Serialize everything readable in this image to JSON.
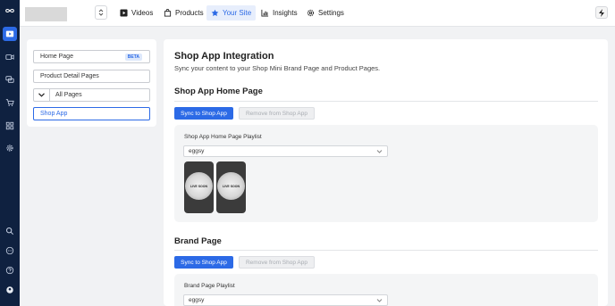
{
  "rail": {
    "top_icons": [
      "infinity-logo-icon",
      "video-library-icon",
      "camera-icon",
      "chat-icon",
      "cart-icon",
      "grid-icon",
      "gear-icon"
    ],
    "bottom_icons": [
      "search-icon",
      "message-icon",
      "help-icon",
      "profile-icon"
    ]
  },
  "topbar": {
    "nav": [
      {
        "label": "Videos",
        "icon": "play-icon"
      },
      {
        "label": "Products",
        "icon": "bag-icon"
      },
      {
        "label": "Your Site",
        "icon": "star-icon",
        "active": true
      },
      {
        "label": "Insights",
        "icon": "bar-chart-icon"
      },
      {
        "label": "Settings",
        "icon": "gear-icon"
      }
    ]
  },
  "sidebar": {
    "items": [
      {
        "label": "Home Page",
        "badge": "BETA"
      },
      {
        "label": "Product Detail Pages"
      },
      {
        "label": "All Pages"
      },
      {
        "label": "Shop App",
        "selected": true
      }
    ]
  },
  "main": {
    "title": "Shop App Integration",
    "subtitle": "Sync your content to your Shop Mini Brand Page and Product Pages.",
    "sections": [
      {
        "heading": "Shop App Home Page",
        "sync_label": "Sync to Shop App",
        "remove_label": "Remove from Shop App",
        "playlist_label": "Shop App Home Page Playlist",
        "playlist_value": "eggsy",
        "thumbnails": [
          "LIVE SOON",
          "LIVE SOON"
        ]
      },
      {
        "heading": "Brand Page",
        "sync_label": "Sync to Shop App",
        "remove_label": "Remove from Shop App",
        "playlist_label": "Brand Page Playlist",
        "playlist_value": "eggsy"
      }
    ]
  },
  "colors": {
    "accent": "#2c6ae6",
    "rail_bg": "#0f2140",
    "page_bg": "#f1f2f4"
  }
}
